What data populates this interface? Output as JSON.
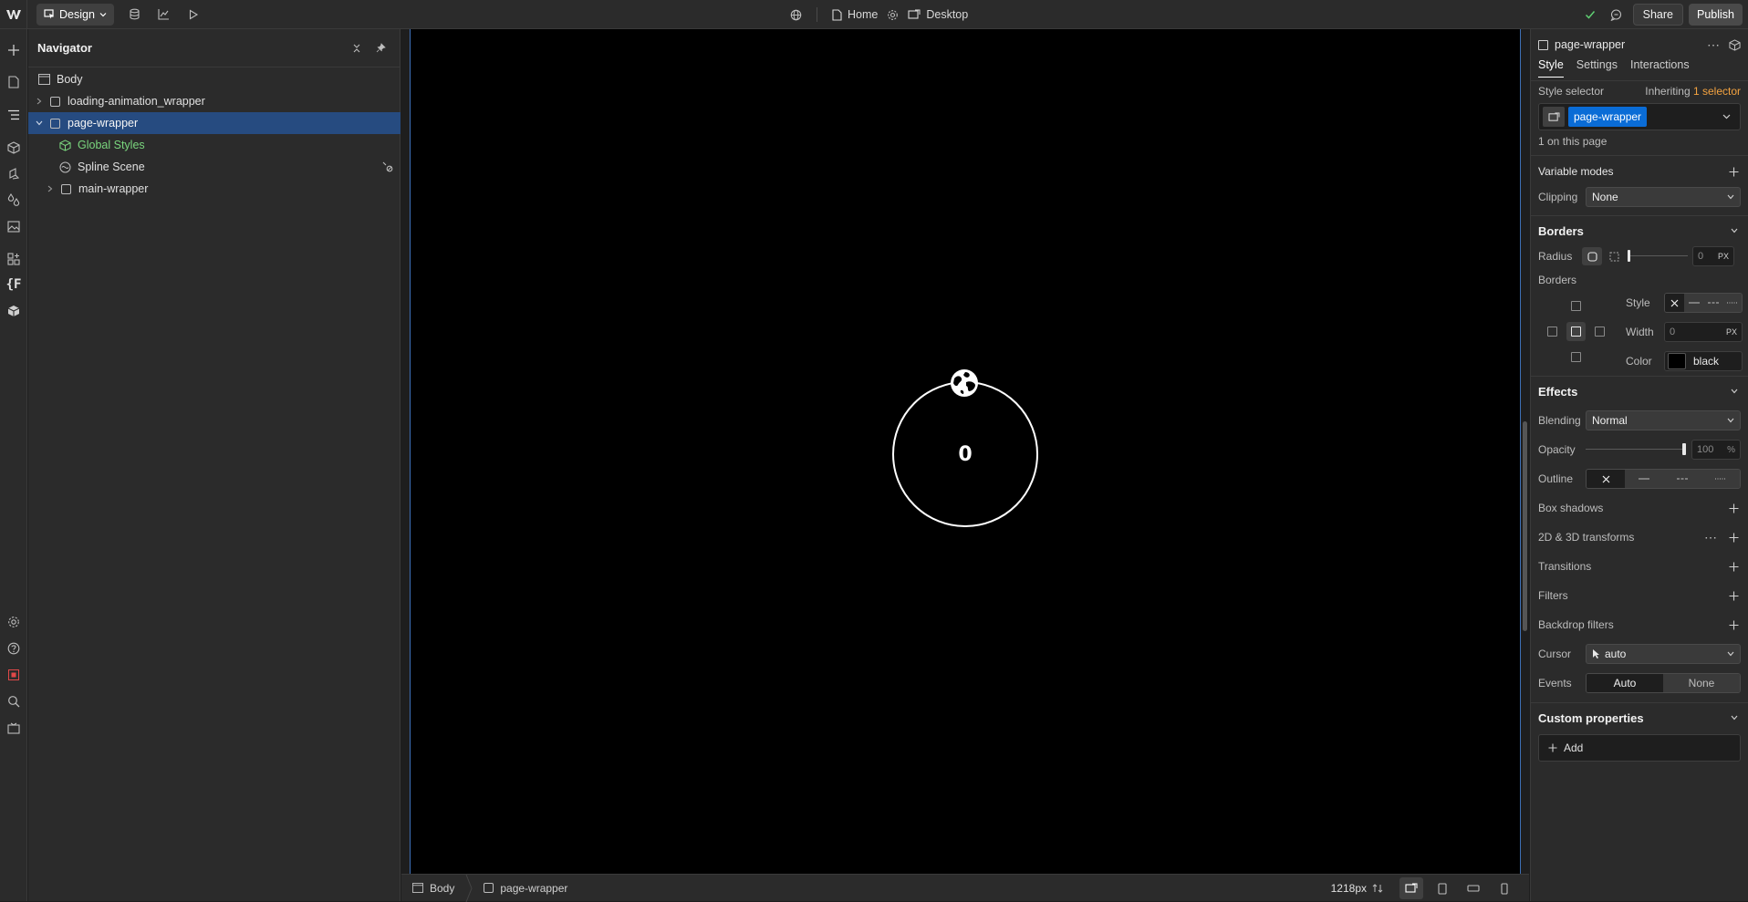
{
  "topbar": {
    "mode_label": "Design",
    "page_label": "Home",
    "breakpoint_label": "Desktop",
    "share_label": "Share",
    "publish_label": "Publish"
  },
  "navigator": {
    "title": "Navigator",
    "items": [
      {
        "label": "Body"
      },
      {
        "label": "loading-animation_wrapper"
      },
      {
        "label": "page-wrapper"
      },
      {
        "label": "Global Styles"
      },
      {
        "label": "Spline Scene"
      },
      {
        "label": "main-wrapper"
      }
    ]
  },
  "canvas": {
    "loader_value": "0"
  },
  "bottombar": {
    "crumbs": [
      "Body",
      "page-wrapper"
    ],
    "width_label": "1218px"
  },
  "panel": {
    "element_name": "page-wrapper",
    "tabs": [
      "Style",
      "Settings",
      "Interactions"
    ],
    "style_selector_label": "Style selector",
    "inheriting_label": "Inheriting",
    "inheriting_link": "1 selector",
    "selector_tag": "page-wrapper",
    "on_page_label": "1 on this page",
    "variable_modes_label": "Variable modes",
    "clipping_label": "Clipping",
    "clipping_value": "None",
    "borders_title": "Borders",
    "radius_label": "Radius",
    "radius_value": "0",
    "radius_unit": "PX",
    "borders_sub_label": "Borders",
    "style_label": "Style",
    "width_label": "Width",
    "width_value": "0",
    "width_unit": "PX",
    "color_label": "Color",
    "color_value": "black",
    "effects_title": "Effects",
    "blending_label": "Blending",
    "blending_value": "Normal",
    "opacity_label": "Opacity",
    "opacity_value": "100",
    "opacity_unit": "%",
    "opacity_level": 1.0,
    "outline_label": "Outline",
    "box_shadows_label": "Box shadows",
    "transforms_label": "2D & 3D transforms",
    "transitions_label": "Transitions",
    "filters_label": "Filters",
    "backdrop_filters_label": "Backdrop filters",
    "cursor_label": "Cursor",
    "cursor_value": "auto",
    "events_label": "Events",
    "events_options": [
      "Auto",
      "None"
    ],
    "custom_props_title": "Custom properties",
    "add_label": "Add"
  }
}
